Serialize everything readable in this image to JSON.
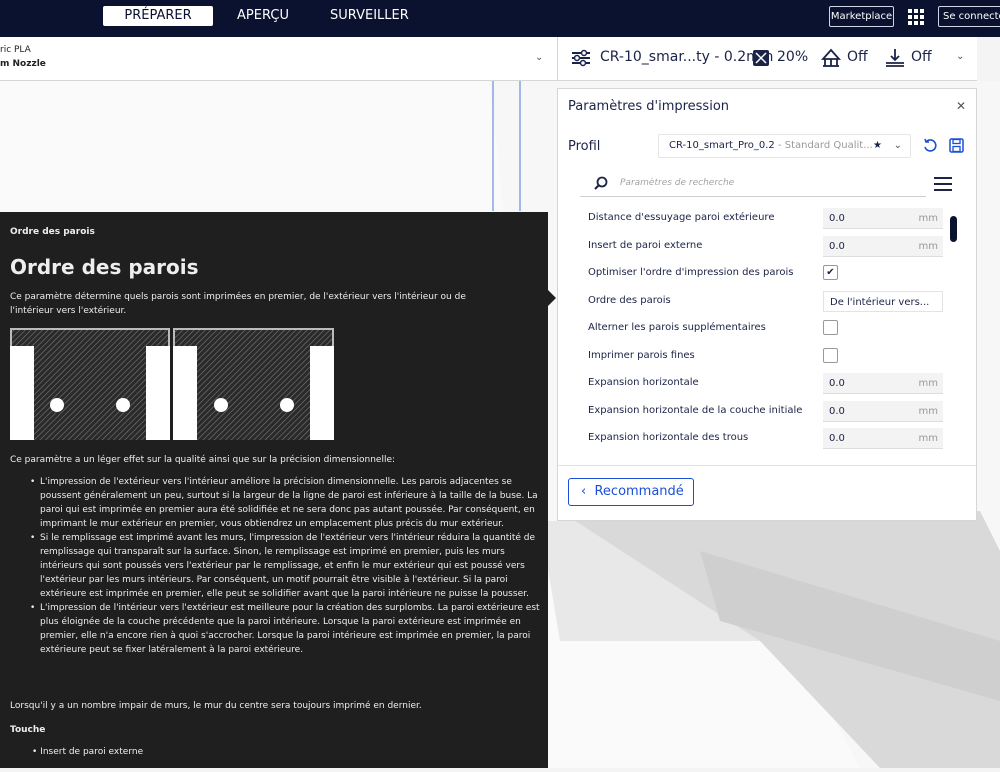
{
  "topbar": {
    "tabs": [
      "PRÉPARER",
      "APERÇU",
      "SURVEILLER"
    ],
    "marketplace": "Marketplace",
    "connect": "Se connecter"
  },
  "material": {
    "line1": "ric PLA",
    "line2": "m Nozzle"
  },
  "print_bar": {
    "profile": "CR-10_smar...ty - 0.2mm",
    "infill": "20%",
    "support": "Off",
    "adhesion": "Off"
  },
  "panel": {
    "title": "Paramètres d'impression",
    "profil_label": "Profil",
    "profil_value": "CR-10_smart_Pro_0.2",
    "profil_sub": " - Standard Qualit...",
    "search_placeholder": "Paramètres de recherche",
    "settings": [
      {
        "label": "Distance d'essuyage paroi extérieure",
        "value": "0.0",
        "unit": "mm"
      },
      {
        "label": "Insert de paroi externe",
        "value": "0.0",
        "unit": "mm"
      },
      {
        "label": "Optimiser l'ordre d'impression des parois",
        "checked": "✔"
      },
      {
        "label": "Ordre des parois",
        "value": "De l'intérieur vers..."
      },
      {
        "label": "Alterner les parois supplémentaires",
        "checked": ""
      },
      {
        "label": "Imprimer parois fines",
        "checked": ""
      },
      {
        "label": "Expansion horizontale",
        "value": "0.0",
        "unit": "mm"
      },
      {
        "label": "Expansion horizontale de la couche initiale",
        "value": "0.0",
        "unit": "mm"
      },
      {
        "label": "Expansion horizontale des trous",
        "value": "0.0",
        "unit": "mm"
      }
    ],
    "recommended": "Recommandé"
  },
  "tooltip": {
    "small_title": "Ordre des parois",
    "title": "Ordre des parois",
    "description": "Ce paramètre détermine quels parois sont imprimées en premier, de l'extérieur vers l'intérieur ou de l'intérieur vers l'extérieur.",
    "intro": "Ce paramètre a un léger effet sur la qualité ainsi que sur la précision dimensionnelle:",
    "bullets": [
      "L'impression de l'extérieur vers l'intérieur améliore la précision dimensionnelle. Les parois adjacentes se poussent généralement un peu, surtout si la largeur de la ligne de paroi est inférieure à la taille de la buse. La paroi qui est imprimée en premier aura été solidifiée et ne sera donc pas autant poussée. Par conséquent, en imprimant le mur extérieur en premier, vous obtiendrez un emplacement plus précis du mur extérieur.",
      "Si le remplissage est imprimé avant les murs, l'impression de l'extérieur vers l'intérieur réduira la quantité de remplissage qui transparaît sur la surface. Sinon, le remplissage est imprimé en premier, puis les murs intérieurs qui sont poussés vers l'extérieur par le remplissage, et enfin le mur extérieur qui est poussé vers l'extérieur par les murs intérieurs. Par conséquent, un motif pourrait être visible à l'extérieur. Si la paroi extérieure est imprimée en premier, elle peut se solidifier avant que la paroi intérieure ne puisse la pousser.",
      "L'impression de l'intérieur vers l'extérieur est meilleure pour la création des surplombs. La paroi extérieure est plus éloignée de la couche précédente que la paroi intérieure. Lorsque la paroi extérieure est imprimée en premier, elle n'a encore rien à quoi s'accrocher. Lorsque la paroi intérieure est imprimée en premier, la paroi extérieure peut se fixer latéralement à la paroi extérieure."
    ],
    "note": "Lorsqu'il y a un nombre impair de murs, le mur du centre sera toujours imprimé en dernier.",
    "touche": "Touche",
    "touche_item": "Insert de paroi externe"
  }
}
